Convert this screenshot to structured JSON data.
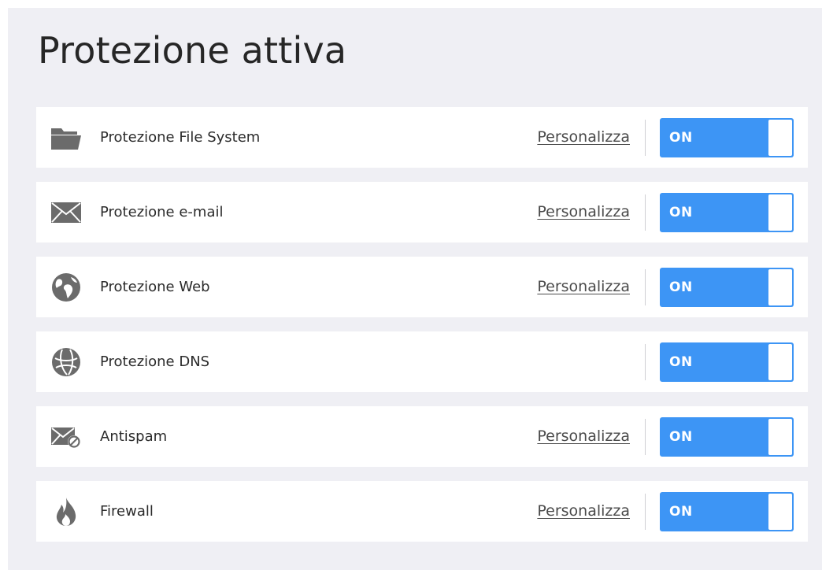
{
  "page": {
    "title": "Protezione attiva"
  },
  "rows": [
    {
      "label": "Protezione File System",
      "link": "Personalizza",
      "toggle": "ON",
      "icon": "folder-icon"
    },
    {
      "label": "Protezione e-mail",
      "link": "Personalizza",
      "toggle": "ON",
      "icon": "envelope-icon"
    },
    {
      "label": "Protezione Web",
      "link": "Personalizza",
      "toggle": "ON",
      "icon": "globe-icon"
    },
    {
      "label": "Protezione DNS",
      "link": "",
      "toggle": "ON",
      "icon": "dns-globe-icon"
    },
    {
      "label": "Antispam",
      "link": "Personalizza",
      "toggle": "ON",
      "icon": "envelope-blocked-icon"
    },
    {
      "label": "Firewall",
      "link": "Personalizza",
      "toggle": "ON",
      "icon": "flame-icon"
    }
  ],
  "colors": {
    "panel_background": "#efeff4",
    "row_background": "#ffffff",
    "toggle_on": "#3d95f5",
    "icon": "#6b6b6b"
  }
}
